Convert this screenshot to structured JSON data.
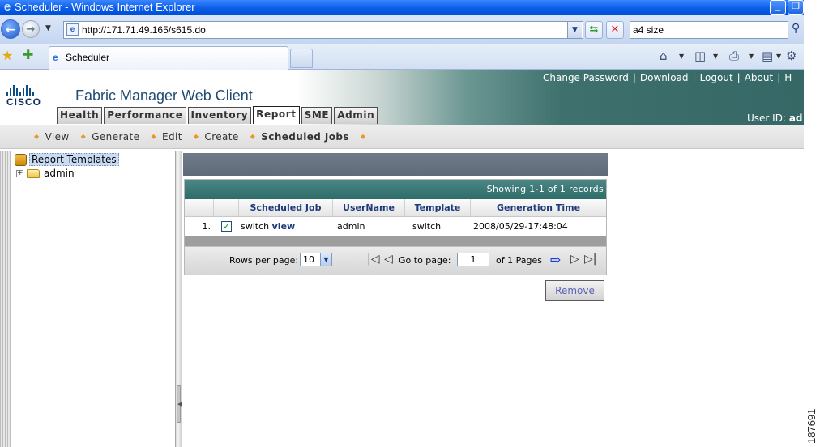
{
  "window": {
    "title": "Scheduler - Windows Internet Explorer",
    "minimize_label": "_",
    "restore_label": "❐"
  },
  "browser": {
    "url": "http://171.71.49.165/s615.do",
    "search_value": "a4 size",
    "tab_title": "Scheduler"
  },
  "app": {
    "logo_text": "CISCO",
    "title": "Fabric Manager Web Client",
    "top_links": [
      "Change Password",
      "Download",
      "Logout",
      "About",
      "H"
    ],
    "user_id_label": "User ID:",
    "user_id_value": "ad",
    "tabs": [
      "Health",
      "Performance",
      "Inventory",
      "Report",
      "SME",
      "Admin"
    ],
    "active_tab": "Report"
  },
  "subnav": {
    "items": [
      "View",
      "Generate",
      "Edit",
      "Create",
      "Scheduled Jobs"
    ],
    "current": "Scheduled Jobs"
  },
  "tree": {
    "root_label": "Report Templates",
    "children": [
      "admin"
    ]
  },
  "grid": {
    "summary": "Showing 1-1 of 1 records",
    "columns": [
      "",
      "",
      "Scheduled Job",
      "UserName",
      "Template",
      "Generation Time"
    ],
    "rows": [
      {
        "num": "1.",
        "checked": true,
        "job_name": "switch",
        "job_link": "view",
        "username": "admin",
        "template": "switch",
        "generation_time": "2008/05/29-17:48:04"
      }
    ],
    "pager": {
      "rows_per_page_label": "Rows per page:",
      "rows_per_page_value": "10",
      "go_to_label": "Go to page:",
      "page_value": "1",
      "of_label": "of 1 Pages"
    }
  },
  "actions": {
    "remove_label": "Remove"
  },
  "figure_id": "187691",
  "colors": {
    "header_teal": "#356866",
    "grid_header_text": "#1e3a7a",
    "bullet": "#e7982a"
  }
}
